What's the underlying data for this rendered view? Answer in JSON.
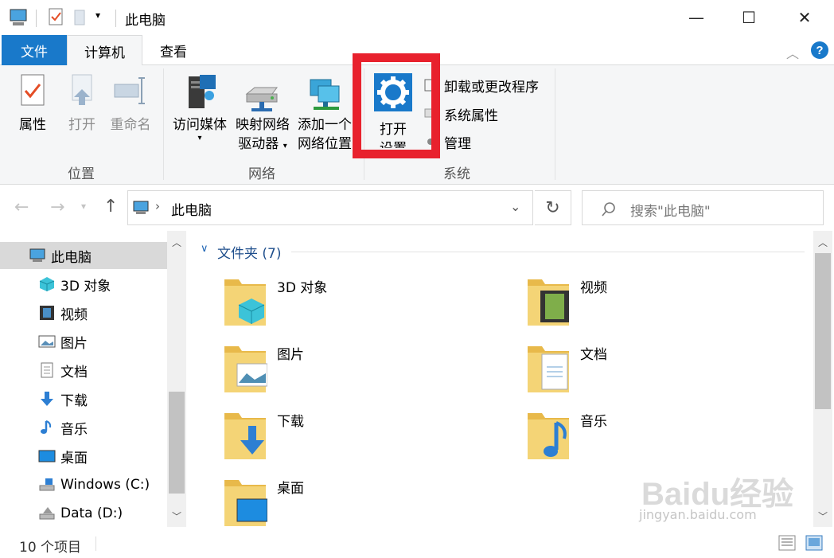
{
  "window": {
    "title": "此电脑",
    "controls": [
      "minimize",
      "maximize",
      "close"
    ]
  },
  "ribbon_tabs": [
    "文件",
    "计算机",
    "查看"
  ],
  "ribbon": {
    "location_group": {
      "label": "位置",
      "buttons": [
        "属性",
        "打开",
        "重命名"
      ]
    },
    "network_group": {
      "label": "网络",
      "access_media": "访问媒体",
      "map_drive_line1": "映射网络",
      "map_drive_line2": "驱动器",
      "add_location_line1": "添加一个",
      "add_location_line2": "网络位置"
    },
    "system_group": {
      "label": "系统",
      "open_settings_line1": "打开",
      "open_settings_line2": "设置",
      "uninstall": "卸载或更改程序",
      "system_properties": "系统属性",
      "manage": "管理"
    }
  },
  "address_bar": {
    "path": "此电脑",
    "search_placeholder": "搜索\"此电脑\""
  },
  "nav_pane": {
    "items": [
      {
        "label": "此电脑",
        "icon": "computer-icon",
        "selected": true
      },
      {
        "label": "3D 对象",
        "icon": "cube-icon"
      },
      {
        "label": "视频",
        "icon": "film-icon"
      },
      {
        "label": "图片",
        "icon": "picture-icon"
      },
      {
        "label": "文档",
        "icon": "document-icon"
      },
      {
        "label": "下载",
        "icon": "download-icon"
      },
      {
        "label": "音乐",
        "icon": "music-icon"
      },
      {
        "label": "桌面",
        "icon": "desktop-icon"
      },
      {
        "label": "Windows (C:)",
        "icon": "drive-icon"
      },
      {
        "label": "Data (D:)",
        "icon": "drive-icon"
      }
    ]
  },
  "content": {
    "section_header": "文件夹 (7)",
    "folders": [
      {
        "name": "3D 对象",
        "icon": "cube-icon"
      },
      {
        "name": "视频",
        "icon": "film-icon"
      },
      {
        "name": "图片",
        "icon": "picture-icon"
      },
      {
        "name": "文档",
        "icon": "document-icon"
      },
      {
        "name": "下载",
        "icon": "download-icon"
      },
      {
        "name": "音乐",
        "icon": "music-icon"
      },
      {
        "name": "桌面",
        "icon": "desktop-icon"
      }
    ]
  },
  "status_bar": {
    "item_count": "10 个项目"
  },
  "watermark": {
    "brand": "Baidu经验",
    "url": "jingyan.baidu.com"
  },
  "colors": {
    "accent": "#1979ca",
    "highlight_box": "#e8212d",
    "selected_nav": "#d9d9d9",
    "folder_yellow": "#f4d476"
  }
}
